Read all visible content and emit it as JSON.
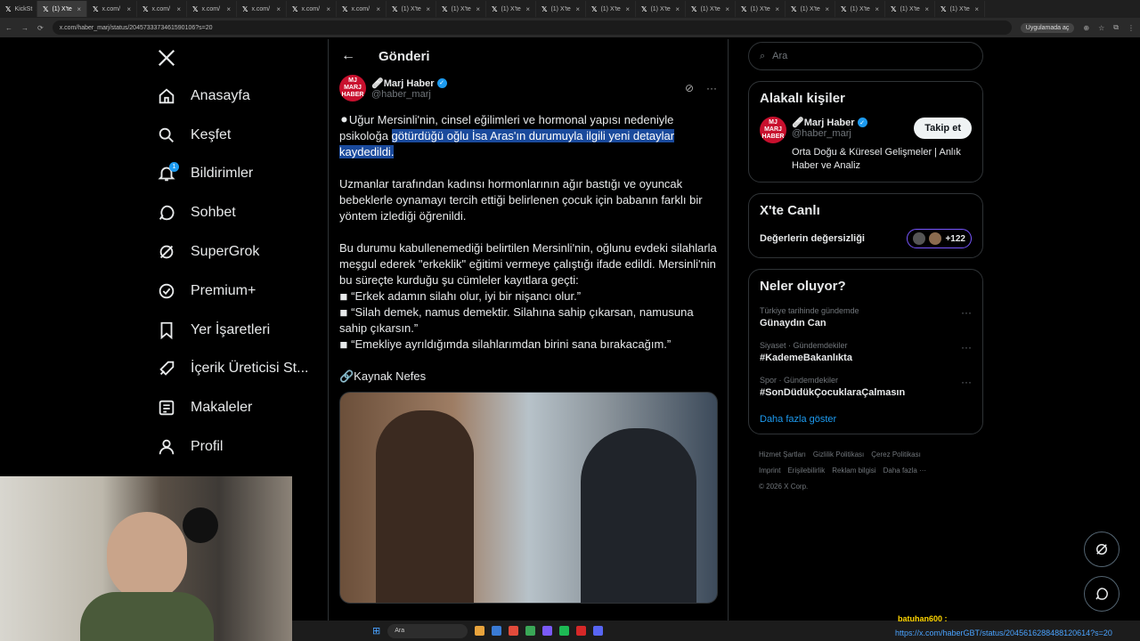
{
  "browser": {
    "tabs": [
      "KickSt",
      "(1) X'te",
      "x.com/",
      "x.com/",
      "x.com/",
      "x.com/",
      "x.com/",
      "x.com/",
      "(1) X'te",
      "(1) X'te",
      "(1) X'te",
      "(1) X'te",
      "(1) X'te",
      "(1) X'te",
      "(1) X'te",
      "(1) X'te",
      "(1) X'te",
      "(1) X'te",
      "(1) X'te",
      "(1) X'te"
    ],
    "url": "x.com/haber_marj/status/2045733373461590106?s=20",
    "open_app_label": "Uygulamada aç"
  },
  "nav": {
    "items": [
      {
        "label": "Anasayfa",
        "icon": "home-icon"
      },
      {
        "label": "Keşfet",
        "icon": "search-icon"
      },
      {
        "label": "Bildirimler",
        "icon": "bell-icon",
        "badge": "1"
      },
      {
        "label": "Sohbet",
        "icon": "chat-icon"
      },
      {
        "label": "SuperGrok",
        "icon": "grok-icon"
      },
      {
        "label": "Premium+",
        "icon": "premium-icon"
      },
      {
        "label": "Yer İşaretleri",
        "icon": "bookmark-icon"
      },
      {
        "label": "İçerik Üreticisi St...",
        "icon": "rocket-icon"
      },
      {
        "label": "Makaleler",
        "icon": "article-icon"
      },
      {
        "label": "Profil",
        "icon": "profile-icon"
      }
    ]
  },
  "post": {
    "header_title": "Gönderi",
    "author_name": "🩹Marj Haber",
    "author_handle": "@haber_marj",
    "avatar_text": "MJ MARJ HABER",
    "para1_plain": "⚫Uğur Mersinli'nin, cinsel eğilimleri ve hormonal yapısı nedeniyle psikoloğa ",
    "para1_highlight": "götürdüğü oğlu İsa Aras'ın durumuyla ilgili yeni detaylar kaydedildi.",
    "para2": "Uzmanlar tarafından kadınsı hormonlarının ağır bastığı ve oyuncak bebeklerle oynamayı tercih ettiği belirlenen çocuk için babanın farklı bir yöntem izlediği öğrenildi.",
    "para3": "Bu durumu kabullenemediği belirtilen Mersinli'nin, oğlunu evdeki silahlarla meşgul ederek \"erkeklik\" eğitimi vermeye çalıştığı ifade edildi. Mersinli'nin bu süreçte kurduğu şu cümleler kayıtlara geçti:",
    "quotes": [
      "◾ “Erkek adamın silahı olur, iyi bir nişancı olur.”",
      "◾ “Silah demek, namus demektir. Silahına sahip çıkarsan, namusuna sahip çıkarsın.”",
      "◾ “Emekliye ayrıldığımda silahlarımdan birini sana bırakacağım.”"
    ],
    "source": "🔗Kaynak Nefes"
  },
  "sidebar": {
    "search_placeholder": "Ara",
    "related_title": "Alakalı kişiler",
    "related_name": "🩹Marj Haber",
    "related_handle": "@haber_marj",
    "related_bio": "Orta Doğu & Küresel Gelişmeler | Anlık Haber ve Analiz",
    "follow_label": "Takip et",
    "live_title": "X'te Canlı",
    "live_topic": "Değerlerin değersizliği",
    "live_count": "+122",
    "trends_title": "Neler oluyor?",
    "trends": [
      {
        "meta": "Türkiye tarihinde gündemde",
        "title": "Günaydın Can"
      },
      {
        "meta": "Siyaset · Gündemdekiler",
        "title": "#KademeBakanlıkta"
      },
      {
        "meta": "Spor · Gündemdekiler",
        "title": "#SonDüdükÇocuklaraÇalmasın"
      }
    ],
    "show_more": "Daha fazla göster",
    "footer_links": [
      "Hizmet Şartları",
      "Gizlilik Politikası",
      "Çerez Politikası",
      "Imprint",
      "Erişilebilirlik",
      "Reklam bilgisi",
      "Daha fazla ···"
    ],
    "copyright": "© 2026 X Corp."
  },
  "taskbar": {
    "search": "Ara",
    "chat_user": "batuhan600 :",
    "chat_link": "https://x.com/haberGBT/status/2045616288488120614?s=20"
  }
}
